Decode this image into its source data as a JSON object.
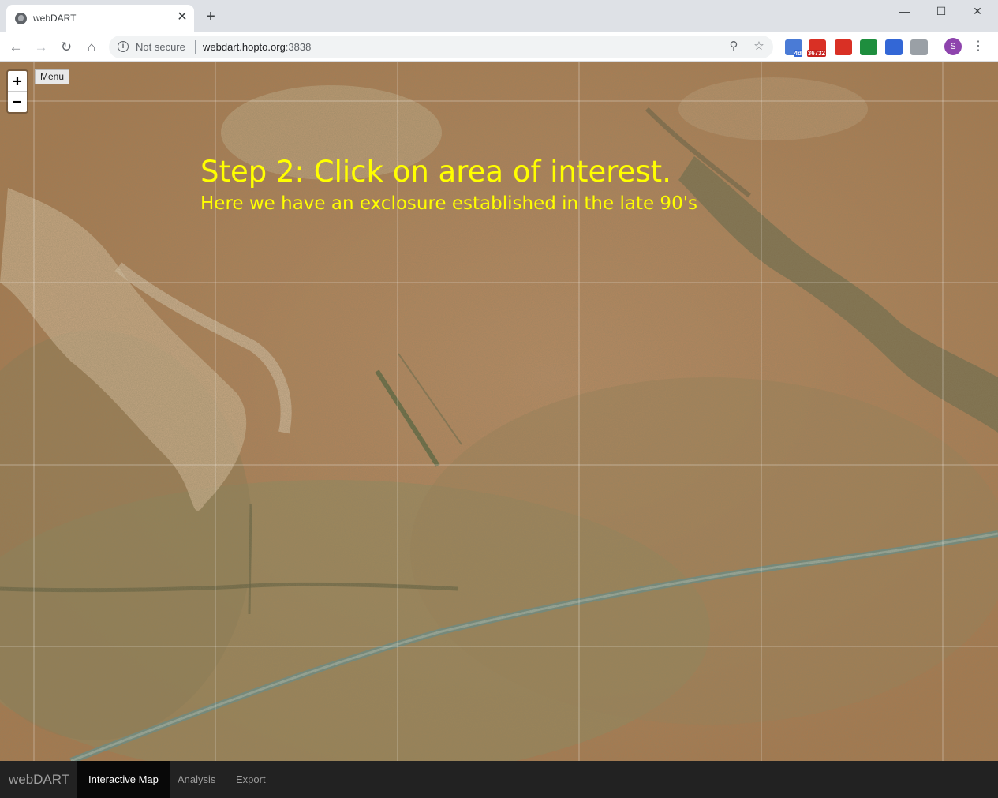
{
  "browser": {
    "tab_title": "webDART",
    "tab_close": "✕",
    "new_tab": "+",
    "window_controls": {
      "minimize": "—",
      "maximize": "☐",
      "close": "✕"
    },
    "nav": {
      "back": "←",
      "forward": "→",
      "reload": "↻",
      "home": "⌂"
    },
    "security_label": "Not secure",
    "url_host": "webdart.hopto.org",
    "url_port": ":3838",
    "extensions": [
      {
        "name": "calendar-extension-icon",
        "badge": "4d",
        "color": "#4a7bd6"
      },
      {
        "name": "gmail-checker-icon",
        "badge": "36732",
        "color": "#d93025"
      },
      {
        "name": "gmail-icon",
        "badge": "",
        "color": "#d93025"
      },
      {
        "name": "checkmark-extension-icon",
        "badge": "",
        "color": "#1e8e3e"
      },
      {
        "name": "shield-extension-icon",
        "badge": "",
        "color": "#3367d6"
      },
      {
        "name": "ghost-extension-icon",
        "badge": "",
        "color": "#9aa0a6"
      }
    ],
    "profile_initial": "S",
    "menu_glyph": "⋮"
  },
  "map": {
    "zoom_in": "+",
    "zoom_out": "−",
    "menu_label": "Menu",
    "step_title": "Step 2: Click on area of interest.",
    "step_subtitle": "Here we have an exclosure established in the late 90's",
    "annotation_color": "#ffff00"
  },
  "app_nav": {
    "brand": "webDART",
    "tabs": [
      {
        "label": "Interactive Map",
        "active": true
      },
      {
        "label": "Analysis",
        "active": false
      },
      {
        "label": "Export",
        "active": false
      }
    ]
  }
}
